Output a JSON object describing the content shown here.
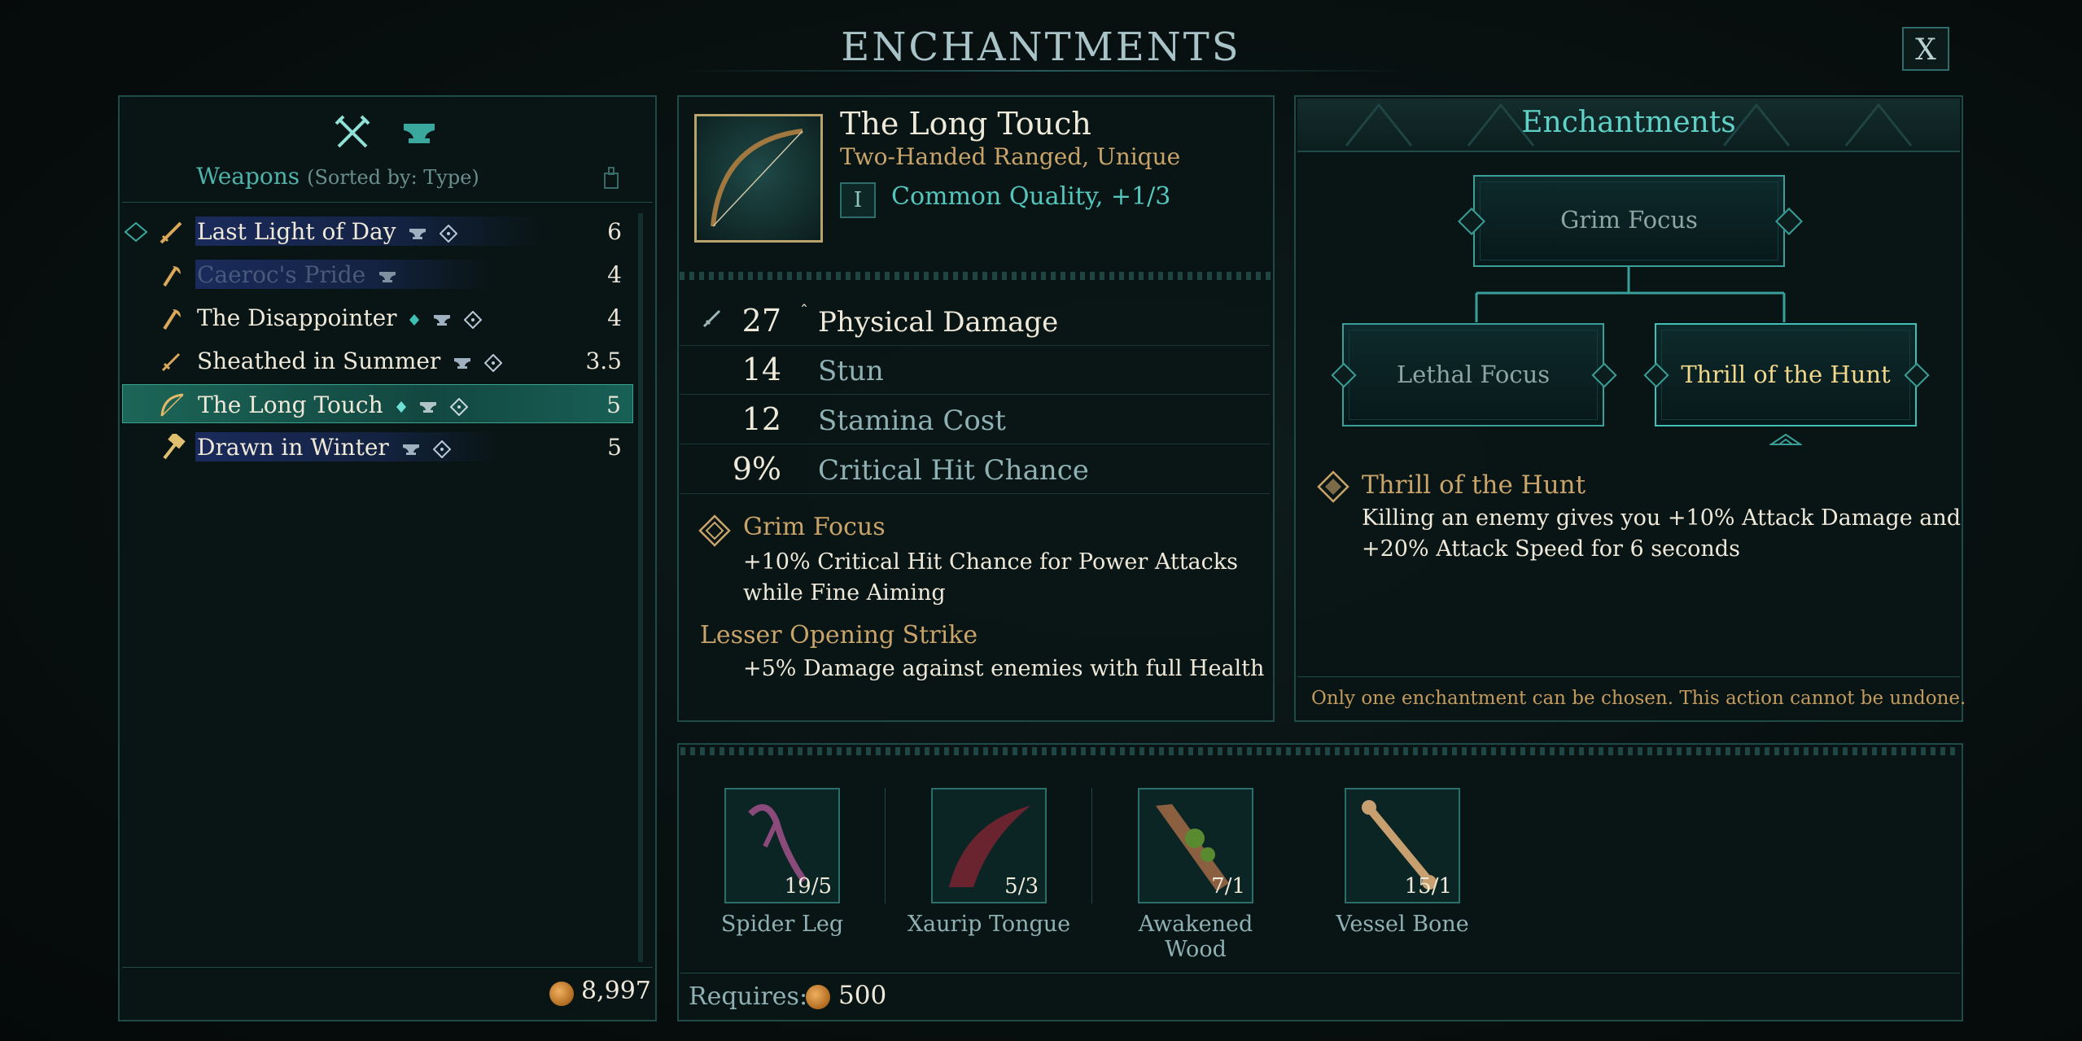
{
  "header": {
    "title": "ENCHANTMENTS",
    "close_label": "X"
  },
  "left_panel": {
    "list_title": "Weapons",
    "list_sort": "(Sorted by: Type)",
    "items": [
      {
        "name": "Last Light of Day",
        "value": "6"
      },
      {
        "name": "Caeroc's Pride",
        "value": "4"
      },
      {
        "name": "The Disappointer",
        "value": "4"
      },
      {
        "name": "Sheathed in Summer",
        "value": "3.5"
      },
      {
        "name": "The Long Touch",
        "value": "5"
      },
      {
        "name": "Drawn in Winter",
        "value": "5"
      }
    ],
    "selected_index": 4,
    "currency": "8,997"
  },
  "item": {
    "name": "The Long Touch",
    "type": "Two-Handed Ranged, Unique",
    "tier": "I",
    "quality": "Common Quality, +1/3",
    "stats": [
      {
        "value": "27",
        "label": "Physical Damage"
      },
      {
        "value": "14",
        "label": "Stun"
      },
      {
        "value": "12",
        "label": "Stamina Cost"
      },
      {
        "value": "9%",
        "label": "Critical Hit Chance"
      }
    ],
    "perks": [
      {
        "name": "Grim Focus",
        "desc": "+10% Critical Hit Chance for Power Attacks while Fine Aiming"
      },
      {
        "name": "Lesser Opening Strike",
        "desc": "+5% Damage against enemies with full Health"
      }
    ]
  },
  "enchant_panel": {
    "title": "Enchantments",
    "tree": {
      "root": "Grim Focus",
      "left": "Lethal Focus",
      "right": "Thrill of the Hunt"
    },
    "selected": {
      "name": "Thrill of the Hunt",
      "desc_line1": "Killing an enemy gives you +10% Attack Damage and",
      "desc_line2": "+20% Attack Speed for 6 seconds"
    },
    "footer": "Only one enchantment can be chosen. This action cannot be undone."
  },
  "materials": {
    "items": [
      {
        "name": "Spider Leg",
        "count": "19/5"
      },
      {
        "name": "Xaurip Tongue",
        "count": "5/3"
      },
      {
        "name": "Awakened Wood",
        "count": "7/1"
      },
      {
        "name": "Vessel Bone",
        "count": "15/1"
      }
    ],
    "requires_label": "Requires:",
    "requires_cost": "500"
  },
  "colors": {
    "accent_teal": "#54c6bd",
    "accent_gold": "#c9a46a",
    "selection_yellow": "#f1d88a",
    "panel_border": "#1f4a48"
  }
}
